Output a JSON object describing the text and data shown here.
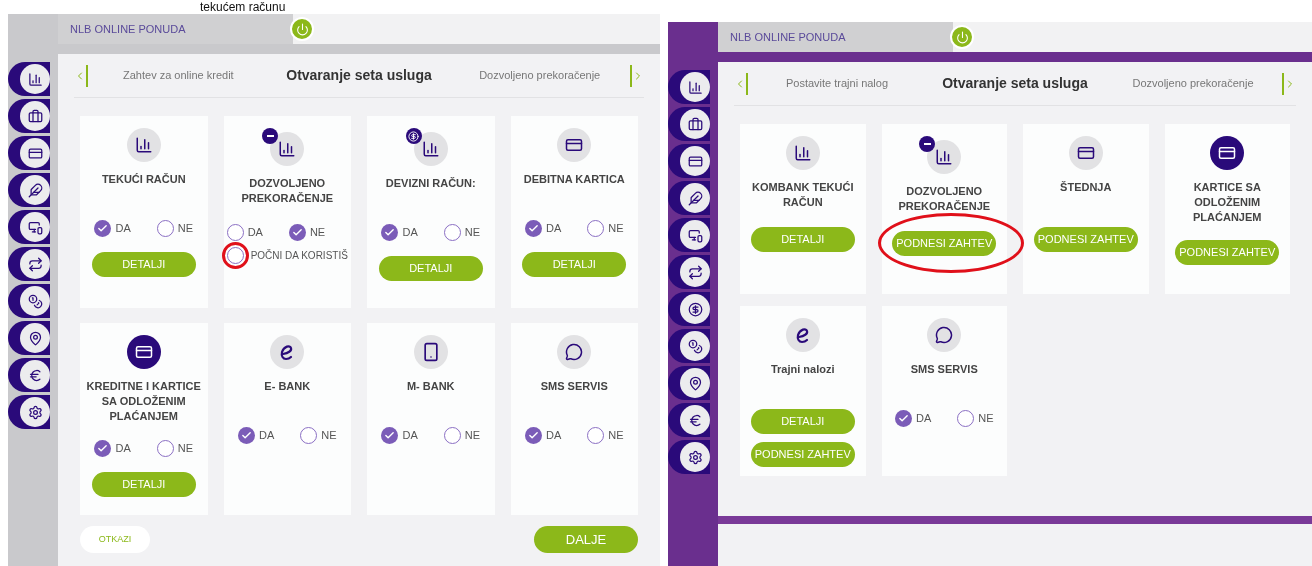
{
  "caption": "tekućem računu",
  "panels": [
    {
      "kind": "gray",
      "header": "NLB ONLINE PONUDA",
      "nav": {
        "previous": "Zahtev za online kredit",
        "current": "Otvaranje seta usluga",
        "next": "Dozvoljeno prekoračenje"
      },
      "cards": [
        {
          "kind": "account",
          "title": "TEKUĆI RAČUN",
          "options": [
            {
              "label": "DA",
              "selected": true
            },
            {
              "label": "NE",
              "selected": false
            }
          ],
          "buttons": [
            {
              "label": "DETALJI"
            }
          ]
        },
        {
          "kind": "overdraft",
          "title": "DOZVOLJENO PREKORAČENJE",
          "options": [
            {
              "label": "DA",
              "selected": false
            },
            {
              "label": "NE",
              "selected": true
            }
          ],
          "extra_option": {
            "label": "POČNI DA KORISTIŠ",
            "selected": false,
            "highlighted": true
          }
        },
        {
          "kind": "foreign",
          "title": "DEVIZNI RAČUN:",
          "options": [
            {
              "label": "DA",
              "selected": true
            },
            {
              "label": "NE",
              "selected": false
            }
          ],
          "buttons": [
            {
              "label": "DETALJI"
            }
          ]
        },
        {
          "kind": "card",
          "title": "DEBITNA KARTICA",
          "options": [
            {
              "label": "DA",
              "selected": true
            },
            {
              "label": "NE",
              "selected": false
            }
          ],
          "buttons": [
            {
              "label": "DETALJI"
            }
          ]
        },
        {
          "kind": "credit",
          "title": "KREDITNE I KARTICE SA ODLOŽENIM PLAĆANJEM",
          "options": [
            {
              "label": "DA",
              "selected": true
            },
            {
              "label": "NE",
              "selected": false
            }
          ],
          "buttons": [
            {
              "label": "DETALJI"
            }
          ]
        },
        {
          "kind": "ebank",
          "title": "E- BANK",
          "options": [
            {
              "label": "DA",
              "selected": true
            },
            {
              "label": "NE",
              "selected": false
            }
          ]
        },
        {
          "kind": "mobile",
          "title": "M- BANK",
          "options": [
            {
              "label": "DA",
              "selected": true
            },
            {
              "label": "NE",
              "selected": false
            }
          ]
        },
        {
          "kind": "sms",
          "title": "SMS SERVIS",
          "options": [
            {
              "label": "DA",
              "selected": true
            },
            {
              "label": "NE",
              "selected": false
            }
          ]
        }
      ],
      "footer": {
        "cancel": "OTKAZI",
        "next": "DALJE"
      }
    },
    {
      "kind": "purple",
      "header": "NLB ONLINE PONUDA",
      "nav": {
        "previous": "Postavite trajni nalog",
        "current": "Otvaranje seta usluga",
        "next": "Dozvoljeno prekoračenje"
      },
      "cards": [
        {
          "kind": "account",
          "title": "KOMBANK TEKUĆI RAČUN",
          "buttons": [
            {
              "label": "DETALJI"
            }
          ]
        },
        {
          "kind": "overdraft",
          "title": "DOZVOLJENO PREKORAČENJE",
          "buttons": [
            {
              "label": "PODNESI ZAHTEV",
              "highlighted": true
            }
          ]
        },
        {
          "kind": "card",
          "title": "ŠTEDNJA",
          "buttons": [
            {
              "label": "PODNESI ZAHTEV"
            }
          ]
        },
        {
          "kind": "credit",
          "title": "KARTICE SA ODLOŽENIM PLAĆANJEM",
          "buttons": [
            {
              "label": "PODNESI ZAHTEV"
            }
          ]
        },
        {
          "kind": "ebank",
          "title": "Trajni nalozi",
          "buttons": [
            {
              "label": "DETALJI"
            },
            {
              "label": "PODNESI ZAHTEV"
            }
          ]
        },
        {
          "kind": "sms",
          "title": "SMS SERVIS",
          "options": [
            {
              "label": "DA",
              "selected": true
            },
            {
              "label": "NE",
              "selected": false
            }
          ]
        }
      ]
    }
  ]
}
